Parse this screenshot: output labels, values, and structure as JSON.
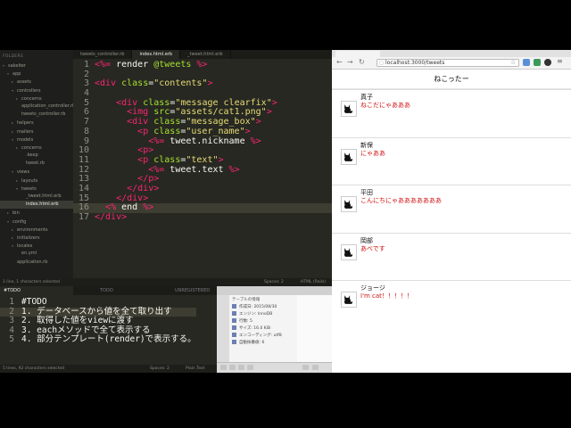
{
  "sidebar": {
    "header": "FOLDERS",
    "items": [
      {
        "label": "sakeiter",
        "indent": 0,
        "open": true
      },
      {
        "label": "app",
        "indent": 1,
        "open": true
      },
      {
        "label": "assets",
        "indent": 2,
        "open": false
      },
      {
        "label": "controllers",
        "indent": 2,
        "open": true
      },
      {
        "label": "concerns",
        "indent": 3,
        "open": false
      },
      {
        "label": "application_controller.rb",
        "indent": 3,
        "file": true
      },
      {
        "label": "tweets_controller.rb",
        "indent": 3,
        "file": true
      },
      {
        "label": "helpers",
        "indent": 2,
        "open": false
      },
      {
        "label": "mailers",
        "indent": 2,
        "open": false
      },
      {
        "label": "models",
        "indent": 2,
        "open": true
      },
      {
        "label": "concerns",
        "indent": 3,
        "open": false
      },
      {
        "label": ".keep",
        "indent": 4,
        "file": true
      },
      {
        "label": "tweet.rb",
        "indent": 4,
        "file": true
      },
      {
        "label": "views",
        "indent": 2,
        "open": true
      },
      {
        "label": "layouts",
        "indent": 3,
        "open": false
      },
      {
        "label": "tweets",
        "indent": 3,
        "open": true
      },
      {
        "label": "_tweet.html.erb",
        "indent": 4,
        "file": true
      },
      {
        "label": "index.html.erb",
        "indent": 4,
        "file": true,
        "selected": true
      },
      {
        "label": "bin",
        "indent": 1,
        "open": false
      },
      {
        "label": "config",
        "indent": 1,
        "open": true
      },
      {
        "label": "environments",
        "indent": 2,
        "open": false
      },
      {
        "label": "initializers",
        "indent": 2,
        "open": false
      },
      {
        "label": "locales",
        "indent": 2,
        "open": true
      },
      {
        "label": "en.yml",
        "indent": 3,
        "file": true
      },
      {
        "label": "application.rb",
        "indent": 2,
        "file": true
      }
    ]
  },
  "editor": {
    "tabs": [
      {
        "label": "tweets_controller.rb",
        "active": false
      },
      {
        "label": "index.html.erb",
        "active": true
      },
      {
        "label": "_tweet.html.erb",
        "active": false
      }
    ],
    "current_line": 16,
    "lines": [
      [
        [
          "pink",
          "<%="
        ],
        [
          "white",
          " render "
        ],
        [
          "green",
          "@tweets"
        ],
        [
          "pink",
          " %>"
        ]
      ],
      [],
      [
        [
          "pink",
          "<div"
        ],
        [
          "green",
          " class"
        ],
        [
          "white",
          "="
        ],
        [
          "yellow",
          "\"contents\""
        ],
        [
          "pink",
          ">"
        ]
      ],
      [],
      [
        [
          "white",
          "    "
        ],
        [
          "pink",
          "<div"
        ],
        [
          "green",
          " class"
        ],
        [
          "white",
          "="
        ],
        [
          "yellow",
          "\"message clearfix\""
        ],
        [
          "pink",
          ">"
        ]
      ],
      [
        [
          "white",
          "      "
        ],
        [
          "pink",
          "<img"
        ],
        [
          "green",
          " src"
        ],
        [
          "white",
          "="
        ],
        [
          "yellow",
          "\"assets/cat1.png\""
        ],
        [
          "pink",
          ">"
        ]
      ],
      [
        [
          "white",
          "      "
        ],
        [
          "pink",
          "<div"
        ],
        [
          "green",
          " class"
        ],
        [
          "white",
          "="
        ],
        [
          "yellow",
          "\"message_box\""
        ],
        [
          "pink",
          ">"
        ]
      ],
      [
        [
          "white",
          "        "
        ],
        [
          "pink",
          "<p"
        ],
        [
          "green",
          " class"
        ],
        [
          "white",
          "="
        ],
        [
          "yellow",
          "\"user_name\""
        ],
        [
          "pink",
          ">"
        ]
      ],
      [
        [
          "white",
          "          "
        ],
        [
          "pink",
          "<%="
        ],
        [
          "white",
          " tweet.nickname "
        ],
        [
          "pink",
          "%>"
        ]
      ],
      [
        [
          "white",
          "        "
        ],
        [
          "pink",
          "<p>"
        ]
      ],
      [
        [
          "white",
          "        "
        ],
        [
          "pink",
          "<p"
        ],
        [
          "green",
          " class"
        ],
        [
          "white",
          "="
        ],
        [
          "yellow",
          "\"text\""
        ],
        [
          "pink",
          ">"
        ]
      ],
      [
        [
          "white",
          "          "
        ],
        [
          "pink",
          "<%="
        ],
        [
          "white",
          " tweet.text "
        ],
        [
          "pink",
          "%>"
        ]
      ],
      [
        [
          "white",
          "        "
        ],
        [
          "pink",
          "</p>"
        ]
      ],
      [
        [
          "white",
          "      "
        ],
        [
          "pink",
          "</div>"
        ]
      ],
      [
        [
          "white",
          "    "
        ],
        [
          "pink",
          "</div>"
        ]
      ],
      [
        [
          "white",
          "  "
        ],
        [
          "pink",
          "<%"
        ],
        [
          "white",
          " end "
        ],
        [
          "pink",
          "%>"
        ]
      ],
      [
        [
          "pink",
          "</div>"
        ]
      ]
    ]
  },
  "status1": {
    "left": "1 line, 1 characters selected",
    "spaces": "Spaces: 2",
    "syntax": "HTML (Rails)"
  },
  "todo": {
    "tabs": [
      "#TODO",
      "TODO",
      "UNREGISTERED"
    ],
    "lines": [
      "#TODO",
      "1. データベースから値を全て取り出す",
      "2. 取得した値をviewに渡す",
      "3. eachメソッドで全て表示する",
      "4. 部分テンプレート(render)で表示する。"
    ],
    "current_line": 2,
    "status_left": "5 lines, 92 characters selected",
    "spaces": "Spaces: 2",
    "syntax": "Plain Text"
  },
  "db": {
    "header": "テーブルの情報",
    "rows": [
      "作成日: 2015/08/30",
      "エンジン: InnoDB",
      "行数: 5",
      "サイズ: 16.0 KiB",
      "エンコーディング: utf8",
      "自動採番値: 6"
    ]
  },
  "browser": {
    "url": "localhost:3000/tweets",
    "page_title": "ねこったー",
    "tweets": [
      {
        "nickname": "真子",
        "text": "ねこだにゃあああ"
      },
      {
        "nickname": "新保",
        "text": "にゃああ"
      },
      {
        "nickname": "平田",
        "text": "こんにちにゃあああああああ"
      },
      {
        "nickname": "岡部",
        "text": "あべです"
      },
      {
        "nickname": "ジョージ",
        "text": "I'm cat！！！！！"
      }
    ]
  },
  "colors": {
    "editor_bg": "#272822",
    "keyword": "#f92672",
    "attr": "#a6e22e",
    "string": "#e6db74",
    "tweet_text": "#d01010"
  }
}
